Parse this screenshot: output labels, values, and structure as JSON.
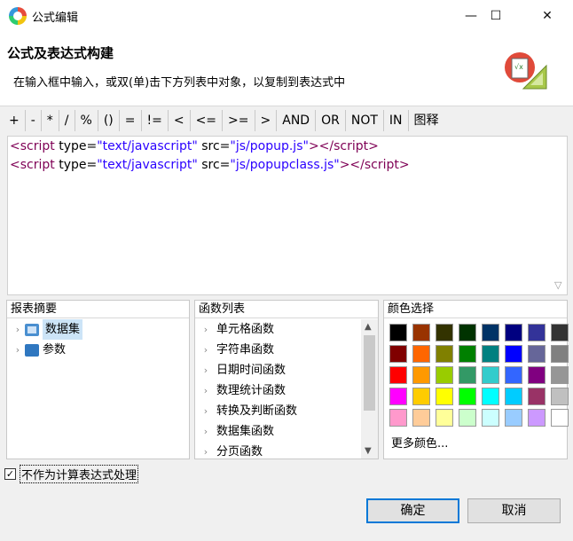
{
  "window": {
    "title": "公式编辑",
    "minimize": "—",
    "maximize": "☐",
    "close": "✕"
  },
  "header": {
    "title": "公式及表达式构建",
    "description": "在输入框中输入，或双(单)击下方列表中对象，以复制到表达式中"
  },
  "toolbar": {
    "buttons": [
      "+",
      "-",
      "*",
      "/",
      "%",
      "()",
      "=",
      "!=",
      "<",
      "<=",
      ">=",
      ">",
      "AND",
      "OR",
      "NOT",
      "IN",
      "图释"
    ]
  },
  "editor": {
    "lines": [
      {
        "lt": "<",
        "tag": "script",
        "attr1": " type=",
        "val1": "\"text/javascript\"",
        "attr2": " src=",
        "val2": "\"js/popup.js\"",
        "close": "></",
        "endtag": "script",
        "gt": ">"
      },
      {
        "lt": "<",
        "tag": "script",
        "attr1": " type=",
        "val1": "\"text/javascript\"",
        "attr2": " src=",
        "val2": "\"js/popupclass.js\"",
        "close": "></",
        "endtag": "script",
        "gt": ">"
      }
    ]
  },
  "report_summary": {
    "title": "报表摘要",
    "items": [
      {
        "label": "数据集",
        "icon": "dataset-icon",
        "selected": true
      },
      {
        "label": "参数",
        "icon": "parameter-icon",
        "selected": false
      }
    ]
  },
  "function_list": {
    "title": "函数列表",
    "items": [
      "单元格函数",
      "字符串函数",
      "日期时间函数",
      "数理统计函数",
      "转换及判断函数",
      "数据集函数",
      "分页函数"
    ]
  },
  "color_picker": {
    "title": "颜色选择",
    "colors": [
      "#000000",
      "#993300",
      "#333300",
      "#003300",
      "#003366",
      "#000080",
      "#333399",
      "#333333",
      "#800000",
      "#ff6600",
      "#808000",
      "#008000",
      "#008080",
      "#0000ff",
      "#666699",
      "#808080",
      "#ff0000",
      "#ff9900",
      "#99cc00",
      "#339966",
      "#33cccc",
      "#3366ff",
      "#800080",
      "#969696",
      "#ff00ff",
      "#ffcc00",
      "#ffff00",
      "#00ff00",
      "#00ffff",
      "#00ccff",
      "#993366",
      "#c0c0c0",
      "#ff99cc",
      "#ffcc99",
      "#ffff99",
      "#ccffcc",
      "#ccffff",
      "#99ccff",
      "#cc99ff",
      "#ffffff"
    ],
    "more_label": "更多颜色..."
  },
  "options": {
    "not_expression_label": "不作为计算表达式处理",
    "not_expression_checked": true,
    "check_mark": "✓"
  },
  "buttons": {
    "ok": "确定",
    "cancel": "取消"
  }
}
